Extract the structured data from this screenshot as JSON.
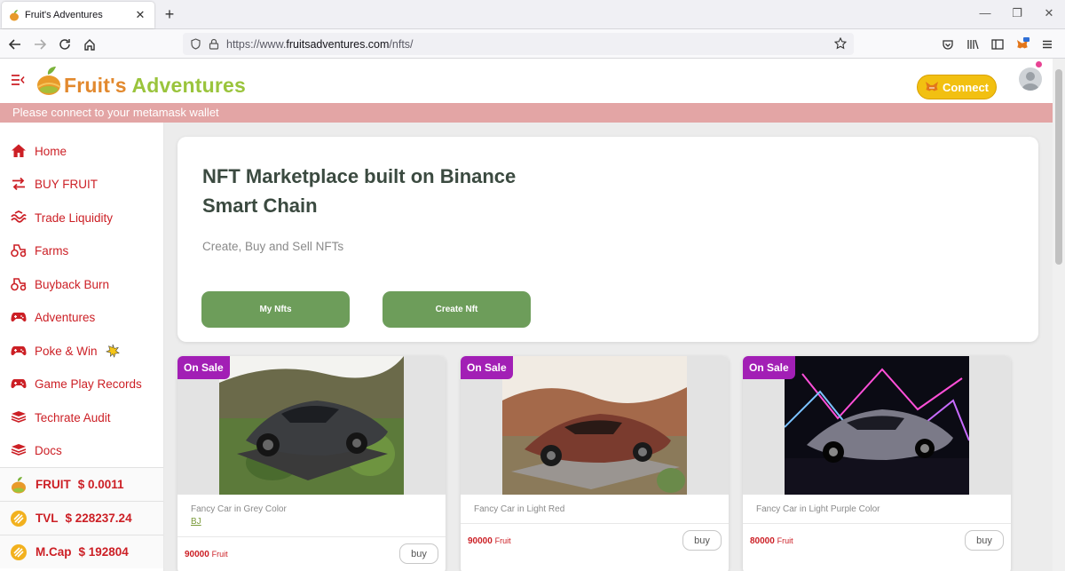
{
  "browser": {
    "tab_title": "Fruit's Adventures",
    "url_prefix": "https://www.",
    "url_domain": "fruitsadventures.com",
    "url_path": "/nfts/"
  },
  "header": {
    "brand_first": "Fruit's",
    "brand_second": " Adventures",
    "connect_label": "Connect"
  },
  "banner": {
    "text": "Please connect to your metamask wallet"
  },
  "sidebar": {
    "items": [
      {
        "label": "Home",
        "icon": "home-icon"
      },
      {
        "label": "BUY FRUIT",
        "icon": "swap-icon"
      },
      {
        "label": "Trade Liquidity",
        "icon": "liquidity-icon"
      },
      {
        "label": "Farms",
        "icon": "tractor-icon"
      },
      {
        "label": "Buyback Burn",
        "icon": "tractor-icon"
      },
      {
        "label": "Adventures",
        "icon": "gamepad-icon"
      },
      {
        "label": "Poke & Win",
        "icon": "gamepad-icon"
      },
      {
        "label": "Game Play Records",
        "icon": "gamepad-icon"
      },
      {
        "label": "Techrate Audit",
        "icon": "book-icon"
      },
      {
        "label": "Docs",
        "icon": "book-icon"
      }
    ],
    "stats": [
      {
        "label": "FRUIT",
        "value": "$ 0.0011"
      },
      {
        "label": "TVL",
        "value": "$ 228237.24"
      },
      {
        "label": "M.Cap",
        "value": "$ 192804"
      }
    ]
  },
  "hero": {
    "title": "NFT Marketplace built on Binance Smart Chain",
    "subtitle": "Create, Buy and Sell NFTs",
    "my_nfts_label": "My Nfts",
    "create_nft_label": "Create Nft"
  },
  "cards": [
    {
      "badge": "On Sale",
      "name": "Fancy Car in Grey Color",
      "owner": "BJ",
      "price": "90000",
      "unit": "Fruit",
      "buy_label": "buy"
    },
    {
      "badge": "On Sale",
      "name": "Fancy Car in Light Red",
      "owner": "",
      "price": "90000",
      "unit": "Fruit",
      "buy_label": "buy"
    },
    {
      "badge": "On Sale",
      "name": "Fancy Car in Light Purple Color",
      "owner": "",
      "price": "80000",
      "unit": "Fruit",
      "buy_label": "buy"
    }
  ],
  "colors": {
    "brand_green": "#9ac43c",
    "brand_orange": "#e2892e",
    "nav_red": "#cc1f25",
    "button_green": "#6d9d5a",
    "badge_purple": "#a21fb5",
    "connect_yellow": "#f2c011",
    "banner_pink": "#e3a5a5"
  }
}
